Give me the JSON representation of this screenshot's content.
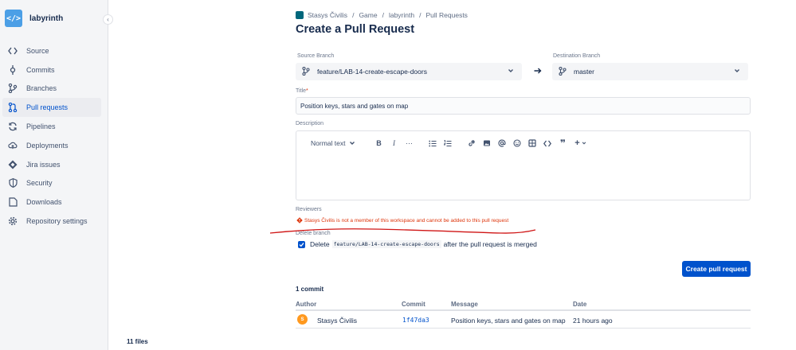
{
  "colors": {
    "primary": "#0052cc",
    "error": "#de350b",
    "avatar": "#ff991f",
    "sidebar_bg": "#f4f5f7",
    "repo_logo": "#4c9fe6"
  },
  "sidebar": {
    "repo_name": "labyrinth",
    "collapse_glyph": "‹",
    "items": [
      {
        "label": "Source",
        "icon": "code-icon"
      },
      {
        "label": "Commits",
        "icon": "commit-icon"
      },
      {
        "label": "Branches",
        "icon": "branch-icon"
      },
      {
        "label": "Pull requests",
        "icon": "pull-request-icon"
      },
      {
        "label": "Pipelines",
        "icon": "pipelines-icon"
      },
      {
        "label": "Deployments",
        "icon": "cloud-icon"
      },
      {
        "label": "Jira issues",
        "icon": "jira-icon"
      },
      {
        "label": "Security",
        "icon": "shield-icon"
      },
      {
        "label": "Downloads",
        "icon": "download-icon"
      },
      {
        "label": "Repository settings",
        "icon": "gear-icon"
      }
    ],
    "files_count": "11 files"
  },
  "breadcrumb": {
    "workspace": "Stasys Čivilis",
    "project": "Game",
    "repo": "labyrinth",
    "section": "Pull Requests",
    "separator": "/"
  },
  "page": {
    "title": "Create a Pull Request"
  },
  "form": {
    "source_label": "Source Branch",
    "source_value": "feature/LAB-14-create-escape-doors",
    "dest_label": "Destination Branch",
    "dest_value": "master",
    "title_label": "Title",
    "required_mark": "*",
    "title_value": "Position keys, stars and gates on map",
    "description_label": "Description",
    "toolbar": {
      "text_style": "Normal text",
      "bold": "B",
      "italic": "I",
      "more": "···",
      "quote": "❞",
      "plus": "+"
    },
    "reviewers_label": "Reviewers",
    "reviewers_error": "Stasys Čivilis is not a member of this workspace and cannot be added to this pull request",
    "delete_branch_label": "Delete branch",
    "delete_prefix": "Delete",
    "delete_branch_code": "feature/LAB-14-create-escape-doors",
    "delete_suffix": "after the pull request is merged",
    "create_button": "Create pull request"
  },
  "commits": {
    "count_label": "1 commit",
    "columns": [
      "Author",
      "Commit",
      "Message",
      "Date"
    ],
    "rows": [
      {
        "avatar": "S",
        "author": "Stasys Čivilis",
        "hash": "1f47da3",
        "message": "Position keys, stars and gates on map",
        "date": "21 hours ago"
      }
    ]
  }
}
